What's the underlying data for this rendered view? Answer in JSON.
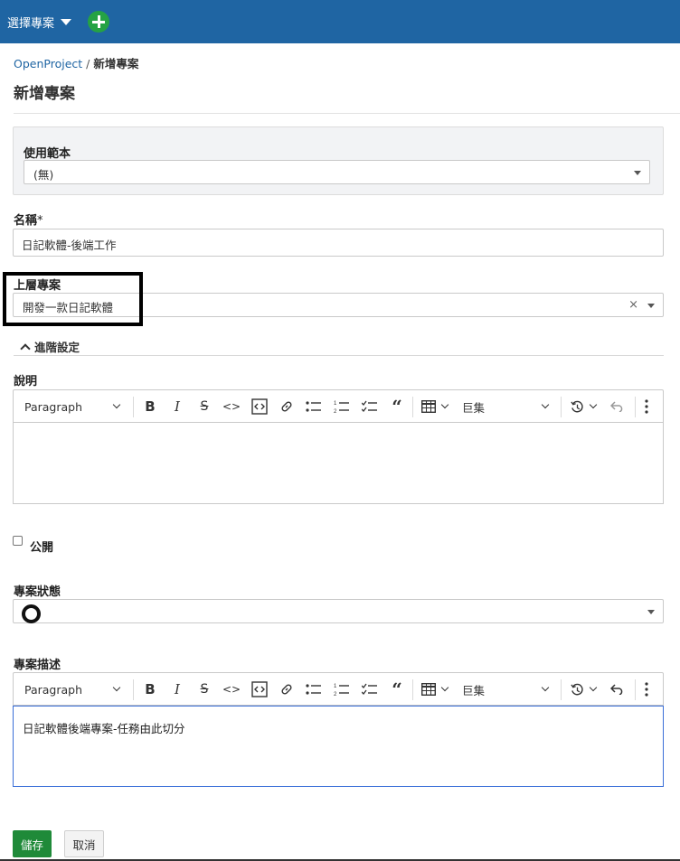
{
  "header": {
    "project_selector_label": "選擇專案",
    "add_icon": "plus-circle-icon",
    "bg_color": "#1f65a3"
  },
  "breadcrumb": {
    "root": "OpenProject",
    "separator": "/",
    "current": "新增專案"
  },
  "page_title": "新增專案",
  "form": {
    "template": {
      "label": "使用範本",
      "value": "(無)"
    },
    "name": {
      "label": "名稱",
      "required_mark": "*",
      "value": "日記軟體-後端工作"
    },
    "parent": {
      "label": "上層專案",
      "value": "開發一款日記軟體",
      "clear_symbol": "×"
    },
    "advanced_toggle": "進階設定",
    "description": {
      "label": "說明",
      "text": ""
    },
    "public": {
      "label": "公開",
      "checked": false
    },
    "status": {
      "label": "專案狀態",
      "value": ""
    },
    "status_explanation": {
      "label": "專案描述",
      "text": "日記軟體後端專案-任務由此切分"
    }
  },
  "editor_toolbar": {
    "paragraph": "Paragraph",
    "bold": "B",
    "italic": "I",
    "strike": "S",
    "code": "<>",
    "macros": "巨集",
    "icons": [
      "chevron-down-icon",
      "bold-icon",
      "italic-icon",
      "strikethrough-icon",
      "code-icon",
      "code-block-icon",
      "link-icon",
      "bullet-list-icon",
      "numbered-list-icon",
      "todo-list-icon",
      "quote-icon",
      "table-icon",
      "history-icon",
      "undo-icon",
      "more-vertical-icon"
    ]
  },
  "buttons": {
    "save": "儲存",
    "cancel": "取消"
  },
  "colors": {
    "save_button": "#1f8a39",
    "add_button": "#25a244",
    "link": "#1f65a3",
    "focus_border": "#3a6fd8"
  }
}
